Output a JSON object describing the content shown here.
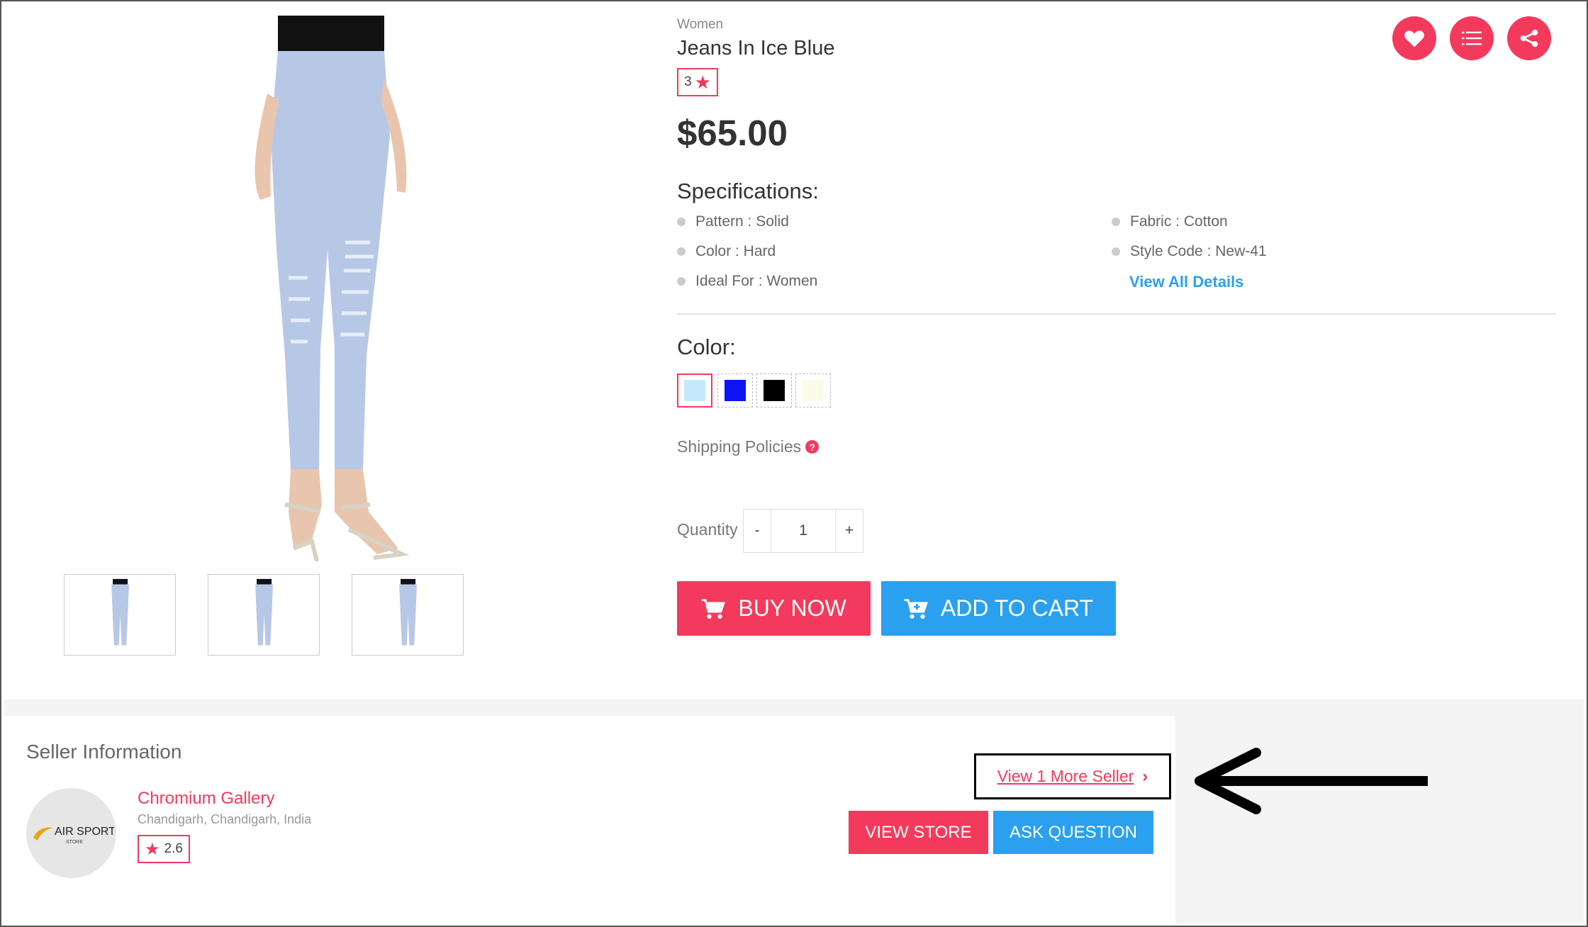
{
  "product": {
    "category": "Women",
    "title": "Jeans In Ice Blue",
    "rating": "3",
    "price": "$65.00",
    "specifications_heading": "Specifications:",
    "specs_left": [
      "Pattern : Solid",
      "Color : Hard",
      "Ideal For : Women"
    ],
    "specs_right": [
      "Fabric : Cotton",
      "Style Code : New-41"
    ],
    "view_all_label": "View All Details",
    "color_heading": "Color:",
    "colors": [
      "#c6e8fb",
      "#0a14f5",
      "#000000",
      "#fbfbea"
    ],
    "selected_color_index": 0,
    "shipping_label": "Shipping Policies",
    "quantity_label": "Quantity",
    "quantity_minus": "-",
    "quantity_value": "1",
    "quantity_plus": "+",
    "buy_now_label": "BUY NOW",
    "add_to_cart_label": "ADD TO CART"
  },
  "actions": {
    "icons": [
      "heart-icon",
      "list-icon",
      "share-icon"
    ]
  },
  "seller": {
    "heading": "Seller Information",
    "logo_text_main": "AIR SPORT",
    "logo_text_sub": "STORE",
    "name": "Chromium Gallery",
    "location": "Chandigarh, Chandigarh, India",
    "rating": "2.6",
    "more_sellers_label": "View 1 More Seller",
    "view_store_label": "VIEW STORE",
    "ask_question_label": "ASK QUESTION"
  },
  "colors": {
    "accent": "#f43a5c",
    "blue": "#2ba0ef"
  }
}
